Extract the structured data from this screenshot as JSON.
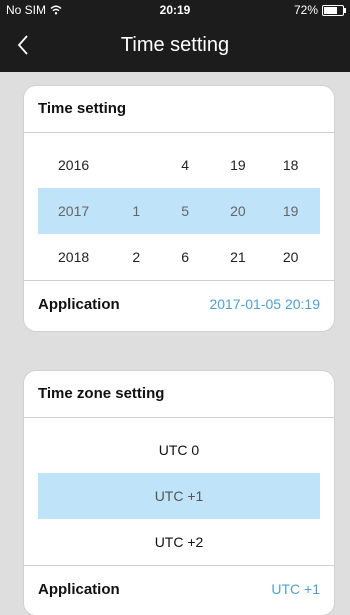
{
  "status": {
    "carrier": "No SIM",
    "time": "20:19",
    "battery_text": "72%",
    "battery_level": 0.72
  },
  "nav": {
    "title": "Time setting"
  },
  "time_card": {
    "title": "Time setting",
    "rows": [
      {
        "year": "2016",
        "month": "",
        "day": "4",
        "hour": "19",
        "minute": "18",
        "selected": false
      },
      {
        "year": "2017",
        "month": "1",
        "day": "5",
        "hour": "20",
        "minute": "19",
        "selected": true
      },
      {
        "year": "2018",
        "month": "2",
        "day": "6",
        "hour": "21",
        "minute": "20",
        "selected": false
      }
    ],
    "application_label": "Application",
    "application_value": "2017-01-05 20:19"
  },
  "zone_card": {
    "title": "Time zone setting",
    "options": [
      "UTC 0",
      "UTC +1",
      "UTC +2"
    ],
    "selected_index": 1,
    "application_label": "Application",
    "application_value": "UTC +1"
  },
  "colors": {
    "accent": "#4ba0d9",
    "selected_bg": "#bfe3f8",
    "bar_bg": "#1c1c1c",
    "page_bg": "#dedede"
  }
}
